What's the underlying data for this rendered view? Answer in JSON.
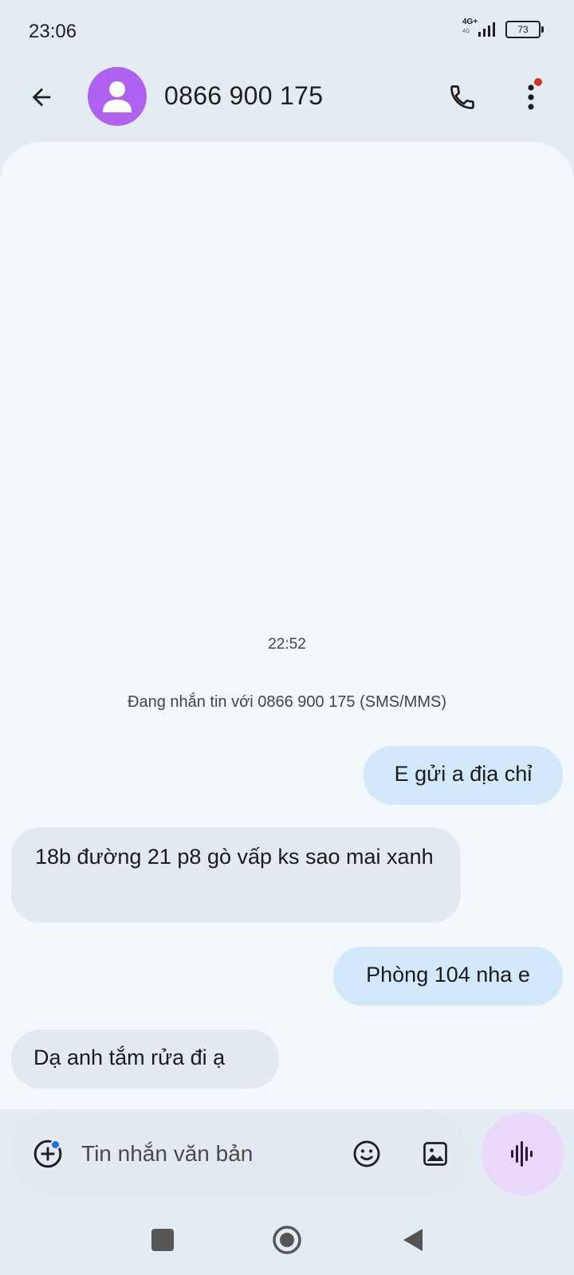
{
  "status_bar": {
    "time": "23:06",
    "network_label": "4G+",
    "network_sub": "4G",
    "battery": "73"
  },
  "header": {
    "contact": "0866 900 175",
    "avatar_color": "#b061f0",
    "icons": {
      "back": "arrow-back-icon",
      "call": "phone-icon",
      "more": "more-vert-icon"
    }
  },
  "thread": {
    "timestamp": "22:52",
    "info": "Đang nhắn tin với 0866 900 175 (SMS/MMS)",
    "messages": [
      {
        "direction": "outgoing",
        "text": "E gửi a địa chỉ"
      },
      {
        "direction": "incoming",
        "text": "18b đường 21 p8 gò vấp ks sao mai xanh"
      },
      {
        "direction": "outgoing",
        "text": "Phòng 104 nha e"
      },
      {
        "direction": "incoming",
        "text": "Dạ anh tắm rửa đi ạ"
      }
    ]
  },
  "composer": {
    "placeholder": "Tin nhắn văn bản",
    "value": "",
    "icons": {
      "attach": "add-circle-icon",
      "emoji": "emoji-icon",
      "gallery": "image-icon",
      "voice": "voice-waveform-icon"
    }
  },
  "colors": {
    "outgoing_bubble": "#d3e8fb",
    "incoming_bubble": "#e3e9f0",
    "voice_button": "#ead8fb",
    "notification_dot": "#d93025"
  }
}
